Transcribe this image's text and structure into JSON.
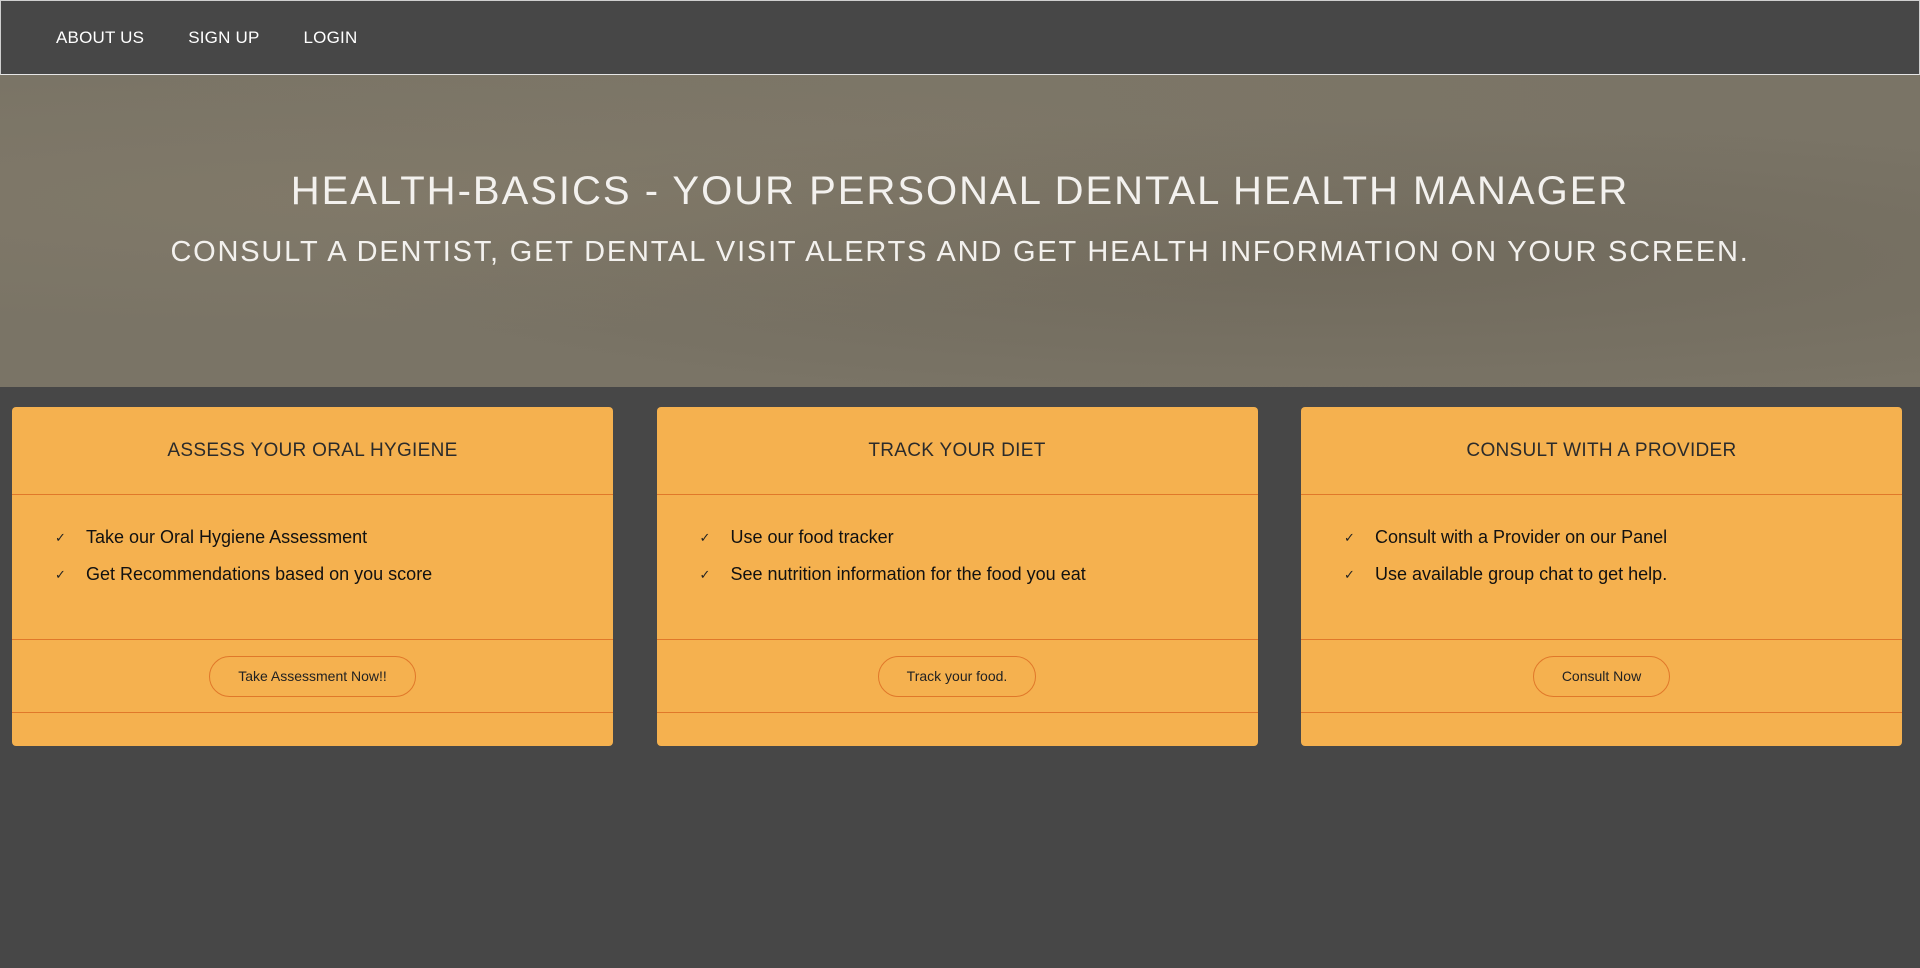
{
  "nav": {
    "items": [
      {
        "label": "ABOUT US"
      },
      {
        "label": "SIGN UP"
      },
      {
        "label": "LOGIN"
      }
    ]
  },
  "hero": {
    "title": "HEALTH-BASICS - YOUR PERSONAL DENTAL HEALTH MANAGER",
    "subtitle": "CONSULT A DENTIST, GET DENTAL VISIT ALERTS AND GET HEALTH INFORMATION ON YOUR SCREEN."
  },
  "cards": [
    {
      "title": "ASSESS YOUR ORAL HYGIENE",
      "features": [
        "Take our Oral Hygiene Assessment",
        "Get Recommendations based on you score"
      ],
      "button": "Take Assessment Now!!"
    },
    {
      "title": "TRACK YOUR DIET",
      "features": [
        "Use our food tracker",
        "See nutrition information for the food you eat"
      ],
      "button": "Track your food."
    },
    {
      "title": "CONSULT WITH A PROVIDER",
      "features": [
        "Consult with a Provider on our Panel",
        "Use available group chat to get help."
      ],
      "button": "Consult Now"
    }
  ],
  "icons": {
    "check": "check-icon"
  },
  "colors": {
    "background": "#474747",
    "card": "#f5b14f",
    "card_border": "#e0782a",
    "hero": "#7a7466"
  }
}
